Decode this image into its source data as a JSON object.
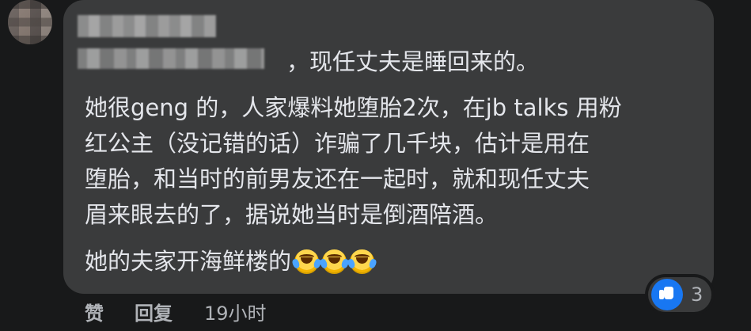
{
  "comment": {
    "author_suffix": "，现任丈夫是睡回来的。",
    "lines": [
      "她很geng 的，人家爆料她堕胎2次，在jb talks 用粉",
      "红公主（没记错的话）诈骗了几千块，估计是用在",
      "堕胎，和当时的前男友还在一起时，就和现任丈夫",
      "眉来眼去的了，据说她当时是倒酒陪酒。"
    ],
    "tail_text": "她的夫家开海鲜楼的",
    "tail_emojis": [
      "rolling-on-floor-laughing-emoji",
      "rolling-on-floor-laughing-emoji",
      "rolling-on-floor-laughing-emoji"
    ]
  },
  "actions": {
    "like_label": "赞",
    "reply_label": "回复",
    "time_label": "19小时"
  },
  "reaction": {
    "icon": "like-thumb-icon",
    "count": "3"
  },
  "colors": {
    "page_bg": "#18191a",
    "bubble_bg": "#3a3b3c",
    "text_primary": "#e4e6eb",
    "text_secondary": "#b0b3b8",
    "like_blue": "#1877f2"
  }
}
